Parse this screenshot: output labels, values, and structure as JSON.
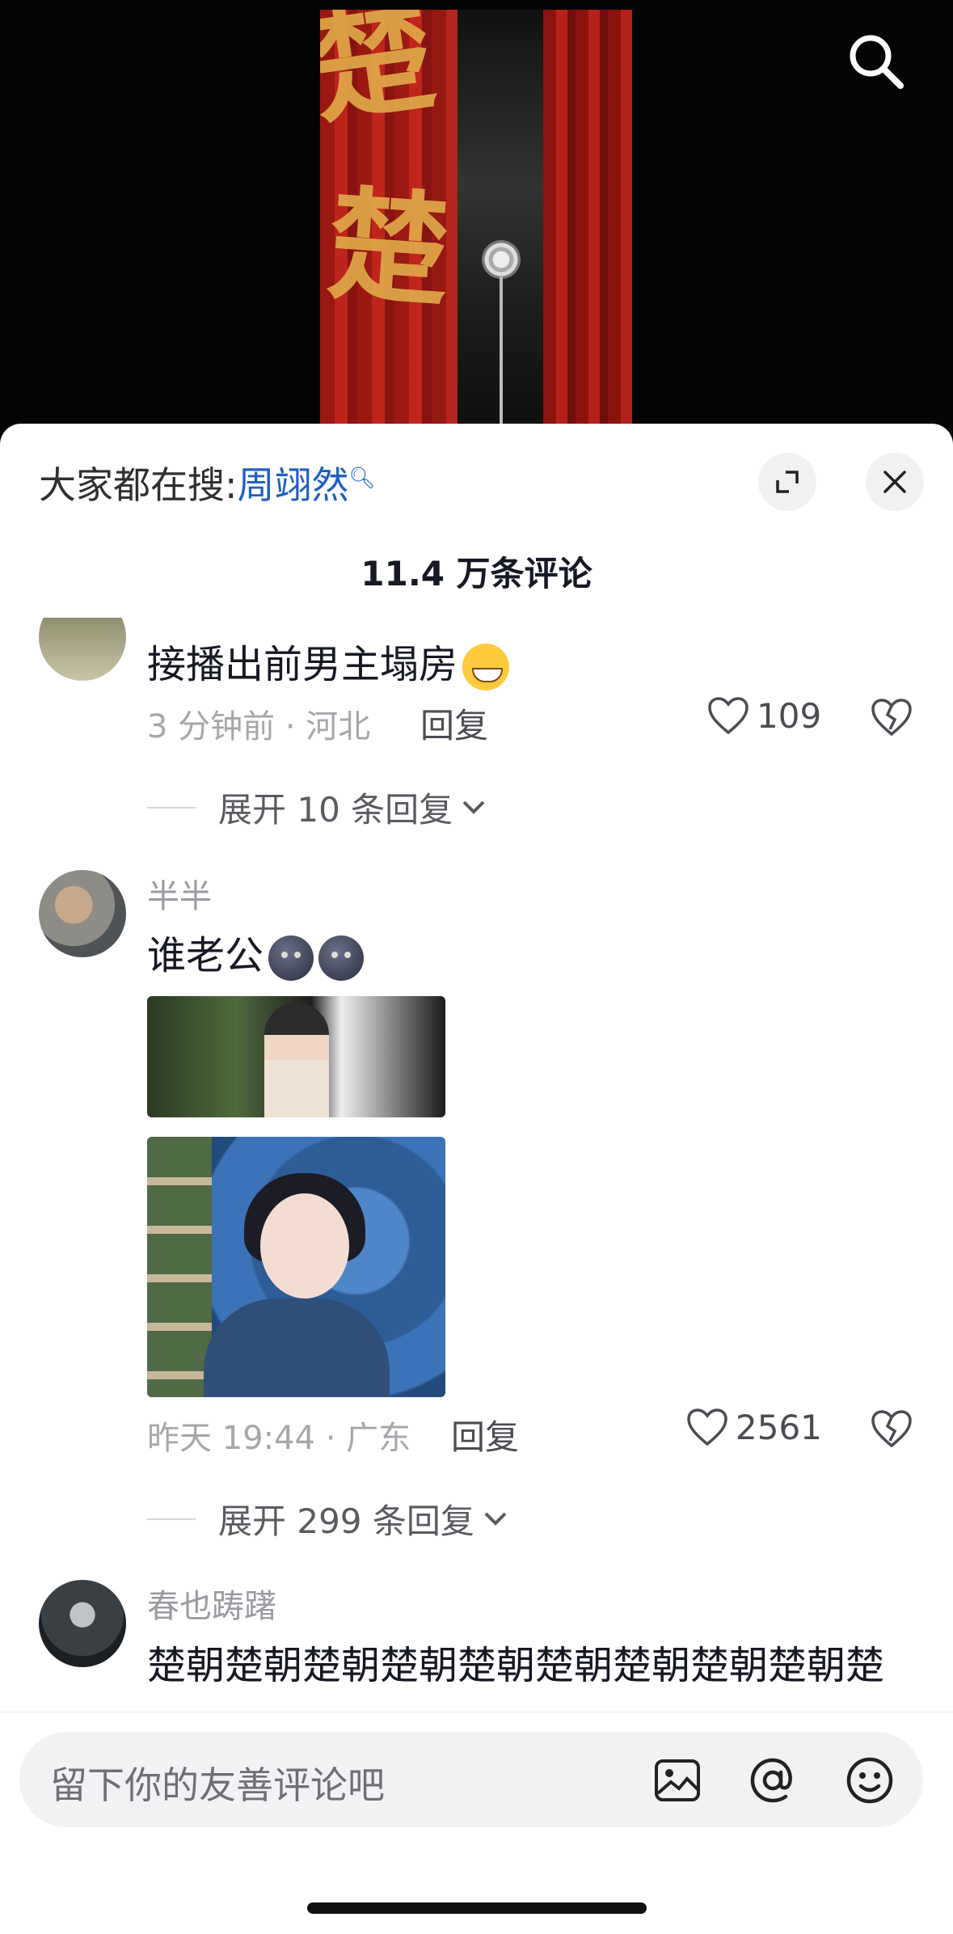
{
  "video": {
    "poster_title": "楚楚"
  },
  "sheet": {
    "hot_search_label": "大家都在搜:",
    "hot_search_keyword": "周翊然",
    "comment_count": "11.4 万条评论"
  },
  "comments": [
    {
      "username": "",
      "text": "接播出前男主塌房",
      "time_location": "3 分钟前 · 河北",
      "reply_label": "回复",
      "likes": "109",
      "expand_label": "展开 10 条回复"
    },
    {
      "username": "半半",
      "text": "谁老公",
      "time_location": "昨天 19:44 · 广东",
      "reply_label": "回复",
      "likes": "2561",
      "expand_label": "展开 299 条回复"
    },
    {
      "username": "春也踌躇",
      "text": "楚朝楚朝楚朝楚朝楚朝楚朝楚朝楚朝楚朝楚"
    }
  ],
  "input": {
    "placeholder": "留下你的友善评论吧"
  },
  "icons": {
    "search": "search-icon",
    "expand": "expand-icon",
    "close": "close-icon",
    "like": "heart-icon",
    "dislike": "broken-heart-icon",
    "image": "image-icon",
    "mention": "at-icon",
    "emoji": "emoji-icon"
  },
  "colors": {
    "keyword": "#1f5fbf",
    "meta": "#a6a6ab",
    "sheet": "#ffffff",
    "video_bg": "#000000"
  }
}
